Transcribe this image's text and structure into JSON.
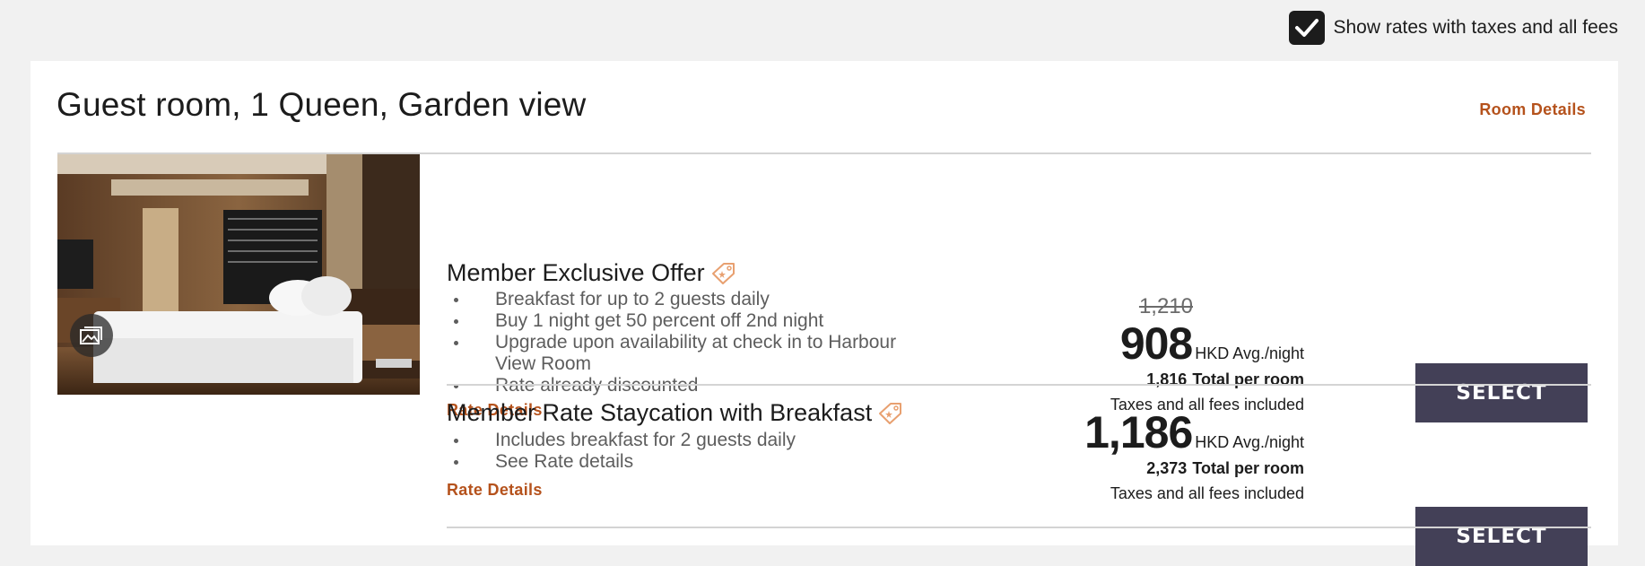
{
  "filter": {
    "checked": true,
    "label": "Show rates with taxes and all fees"
  },
  "room": {
    "title": "Guest room, 1 Queen, Garden view",
    "details_link": "Room Details"
  },
  "rates": [
    {
      "name": "Member Exclusive Offer",
      "features": [
        "Breakfast for up to 2 guests daily",
        "Buy 1 night get 50 percent off 2nd night",
        "Upgrade upon availability at check in to Harbour View Room",
        "Rate already discounted"
      ],
      "details_link": "Rate Details",
      "original_price": "1,210",
      "price": "908",
      "price_unit": "HKD Avg./night",
      "total": "1,816",
      "total_label": "Total per room",
      "fees_note": "Taxes and all fees included",
      "select_label": "SELECT"
    },
    {
      "name": "Member Rate Staycation with Breakfast",
      "features": [
        "Includes breakfast for 2 guests daily",
        "See Rate details"
      ],
      "details_link": "Rate Details",
      "price": "1,186",
      "price_unit": "HKD Avg./night",
      "total": "2,373",
      "total_label": "Total per room",
      "fees_note": "Taxes and all fees included",
      "select_label": "SELECT"
    }
  ],
  "colors": {
    "accent": "#b5521c",
    "button": "#434057",
    "background": "#f1f1f1"
  },
  "icons": {
    "checkbox": "checkmark-icon",
    "gallery": "gallery-icon",
    "tag": "offer-tag-icon"
  }
}
